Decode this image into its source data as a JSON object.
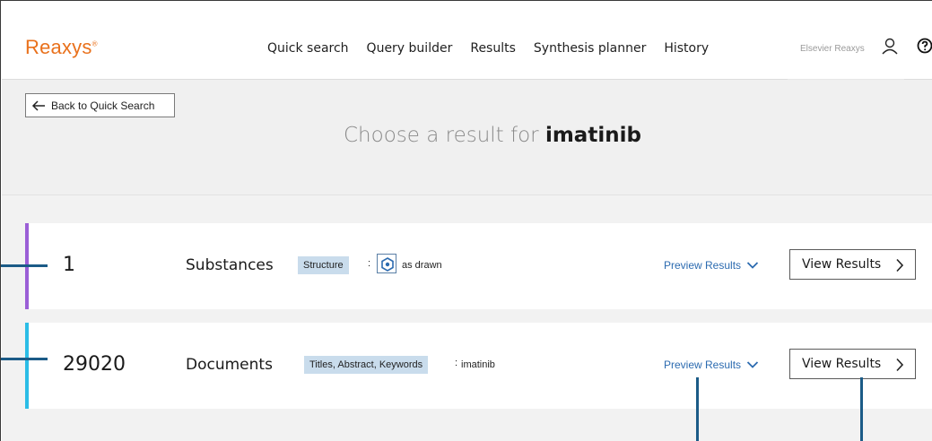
{
  "header": {
    "logo": "Reaxys",
    "logo_mark": "®",
    "nav": [
      "Quick search",
      "Query builder",
      "Results",
      "Synthesis planner",
      "History"
    ],
    "user_label": "Elsevier Reaxys",
    "icons": [
      "user-icon",
      "help-icon"
    ]
  },
  "page": {
    "back_label": "Back to Quick Search",
    "title_prefix": "Choose a result for",
    "title_query": "imatinib"
  },
  "results": [
    {
      "count": "1",
      "type": "Substances",
      "chip": "Structure",
      "colon": ":",
      "suffix": "as drawn",
      "accent": "#9b5fd6",
      "preview_label": "Preview Results",
      "view_label": "View Results"
    },
    {
      "count": "29020",
      "type": "Documents",
      "chip": "Titles, Abstract, Keywords",
      "colon": ":",
      "suffix": "imatinib",
      "accent": "#2bbde6",
      "preview_label": "Preview Results",
      "view_label": "View Results"
    }
  ],
  "colors": {
    "brand": "#e9711c",
    "link": "#2c6bb0",
    "chip_bg": "#c9dcec",
    "callout": "#1b5b87"
  }
}
